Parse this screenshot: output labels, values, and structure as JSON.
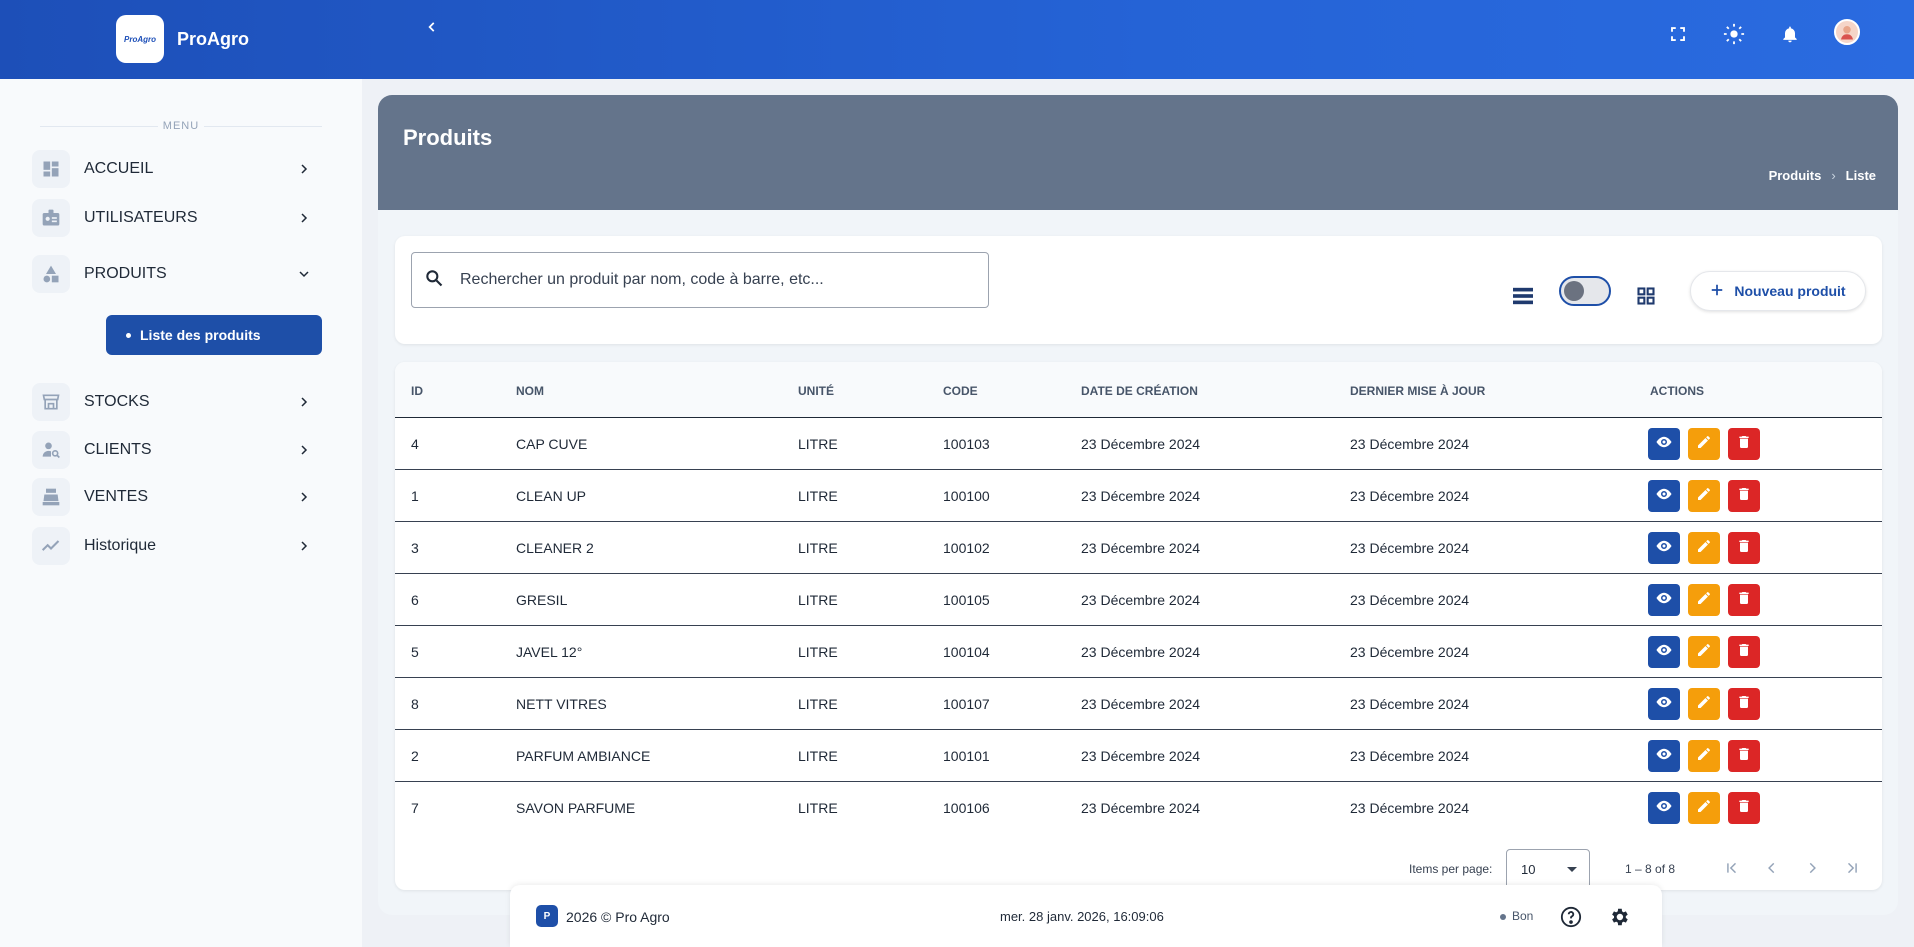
{
  "app": {
    "brand": "ProAgro",
    "logo_text": "ProAgro"
  },
  "sidebar": {
    "menu_label": "MENU",
    "items": [
      {
        "label": "ACCUEIL",
        "icon": "dashboard-icon"
      },
      {
        "label": "UTILISATEURS",
        "icon": "id-badge-icon"
      },
      {
        "label": "PRODUITS",
        "icon": "shapes-icon"
      },
      {
        "label": "STOCKS",
        "icon": "store-icon"
      },
      {
        "label": "CLIENTS",
        "icon": "person-search-icon"
      },
      {
        "label": "VENTES",
        "icon": "cash-register-icon"
      },
      {
        "label": "Historique",
        "icon": "trending-icon"
      }
    ],
    "sub_item": "Liste des produits"
  },
  "page": {
    "title": "Produits",
    "breadcrumb": [
      "Produits",
      "Liste"
    ]
  },
  "toolbar": {
    "search_placeholder": "Rechercher un produit par nom, code à barre, etc...",
    "new_button": "Nouveau produit"
  },
  "table": {
    "headers": [
      "ID",
      "NOM",
      "UNITÉ",
      "CODE",
      "DATE DE CRÉATION",
      "DERNIER MISE À JOUR",
      "ACTIONS"
    ],
    "rows": [
      [
        "4",
        "CAP CUVE",
        "LITRE",
        "100103",
        "23 Décembre 2024",
        "23 Décembre 2024"
      ],
      [
        "1",
        "CLEAN UP",
        "LITRE",
        "100100",
        "23 Décembre 2024",
        "23 Décembre 2024"
      ],
      [
        "3",
        "CLEANER 2",
        "LITRE",
        "100102",
        "23 Décembre 2024",
        "23 Décembre 2024"
      ],
      [
        "6",
        "GRESIL",
        "LITRE",
        "100105",
        "23 Décembre 2024",
        "23 Décembre 2024"
      ],
      [
        "5",
        "JAVEL 12°",
        "LITRE",
        "100104",
        "23 Décembre 2024",
        "23 Décembre 2024"
      ],
      [
        "8",
        "NETT VITRES",
        "LITRE",
        "100107",
        "23 Décembre 2024",
        "23 Décembre 2024"
      ],
      [
        "2",
        "PARFUM AMBIANCE",
        "LITRE",
        "100101",
        "23 Décembre 2024",
        "23 Décembre 2024"
      ],
      [
        "7",
        "SAVON PARFUME",
        "LITRE",
        "100106",
        "23 Décembre 2024",
        "23 Décembre 2024"
      ]
    ]
  },
  "paginator": {
    "items_per_page_label": "Items per page:",
    "items_per_page": "10",
    "range": "1 – 8 of 8"
  },
  "footer": {
    "logo": "P",
    "copyright": "2026 © Pro Agro",
    "datetime": "mer. 28 janv. 2026, 16:09:06",
    "status": "Bon"
  },
  "colors": {
    "primary": "#1e4fa8",
    "topbar": "#2563d6",
    "header": "#64748b",
    "edit": "#f59e0b",
    "delete": "#dc2626"
  }
}
